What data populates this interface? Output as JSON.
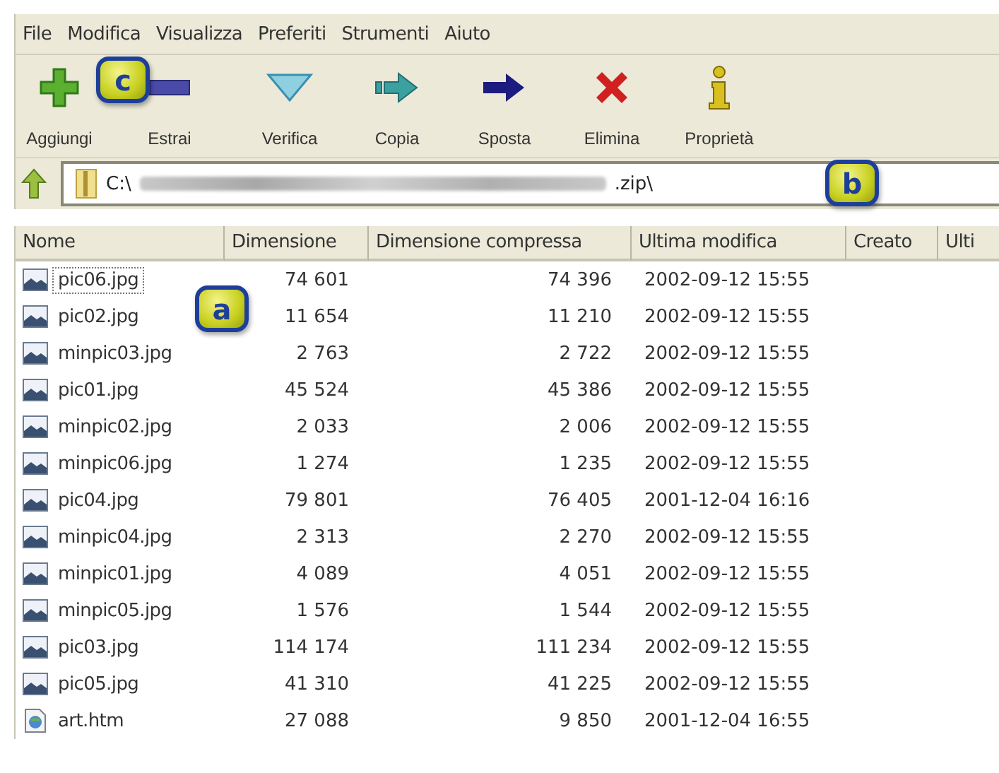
{
  "menu": [
    "File",
    "Modifica",
    "Visualizza",
    "Preferiti",
    "Strumenti",
    "Aiuto"
  ],
  "toolbar": [
    {
      "kind": "add",
      "label": "Aggiungi"
    },
    {
      "kind": "extract",
      "label": "Estrai"
    },
    {
      "kind": "test",
      "label": "Verifica"
    },
    {
      "kind": "copy",
      "label": "Copia"
    },
    {
      "kind": "move",
      "label": "Sposta"
    },
    {
      "kind": "delete",
      "label": "Elimina"
    },
    {
      "kind": "info",
      "label": "Proprietà"
    }
  ],
  "address": {
    "path_start": "C:\\",
    "path_end": ".zip\\"
  },
  "table": {
    "columns": [
      "Nome",
      "Dimensione",
      "Dimensione compressa",
      "Ultima modifica",
      "Creato",
      "Ulti"
    ],
    "rows": [
      {
        "kind": "image",
        "name": "pic06.jpg",
        "size": "74 601",
        "packed": "74 396",
        "modified": "2002-09-12 15:55",
        "focused": true
      },
      {
        "kind": "image",
        "name": "pic02.jpg",
        "size": "11 654",
        "packed": "11 210",
        "modified": "2002-09-12 15:55",
        "focused": false
      },
      {
        "kind": "image",
        "name": "minpic03.jpg",
        "size": "2 763",
        "packed": "2 722",
        "modified": "2002-09-12 15:55",
        "focused": false
      },
      {
        "kind": "image",
        "name": "pic01.jpg",
        "size": "45 524",
        "packed": "45 386",
        "modified": "2002-09-12 15:55",
        "focused": false
      },
      {
        "kind": "image",
        "name": "minpic02.jpg",
        "size": "2 033",
        "packed": "2 006",
        "modified": "2002-09-12 15:55",
        "focused": false
      },
      {
        "kind": "image",
        "name": "minpic06.jpg",
        "size": "1 274",
        "packed": "1 235",
        "modified": "2002-09-12 15:55",
        "focused": false
      },
      {
        "kind": "image",
        "name": "pic04.jpg",
        "size": "79 801",
        "packed": "76 405",
        "modified": "2001-12-04 16:16",
        "focused": false
      },
      {
        "kind": "image",
        "name": "minpic04.jpg",
        "size": "2 313",
        "packed": "2 270",
        "modified": "2002-09-12 15:55",
        "focused": false
      },
      {
        "kind": "image",
        "name": "minpic01.jpg",
        "size": "4 089",
        "packed": "4 051",
        "modified": "2002-09-12 15:55",
        "focused": false
      },
      {
        "kind": "image",
        "name": "minpic05.jpg",
        "size": "1 576",
        "packed": "1 544",
        "modified": "2002-09-12 15:55",
        "focused": false
      },
      {
        "kind": "image",
        "name": "pic03.jpg",
        "size": "114 174",
        "packed": "111 234",
        "modified": "2002-09-12 15:55",
        "focused": false
      },
      {
        "kind": "image",
        "name": "pic05.jpg",
        "size": "41 310",
        "packed": "41 225",
        "modified": "2002-09-12 15:55",
        "focused": false
      },
      {
        "kind": "html",
        "name": "art.htm",
        "size": "27 088",
        "packed": "9 850",
        "modified": "2001-12-04 16:55",
        "focused": false
      }
    ]
  },
  "badges": [
    {
      "letter": "c"
    },
    {
      "letter": "b"
    },
    {
      "letter": "a"
    }
  ]
}
